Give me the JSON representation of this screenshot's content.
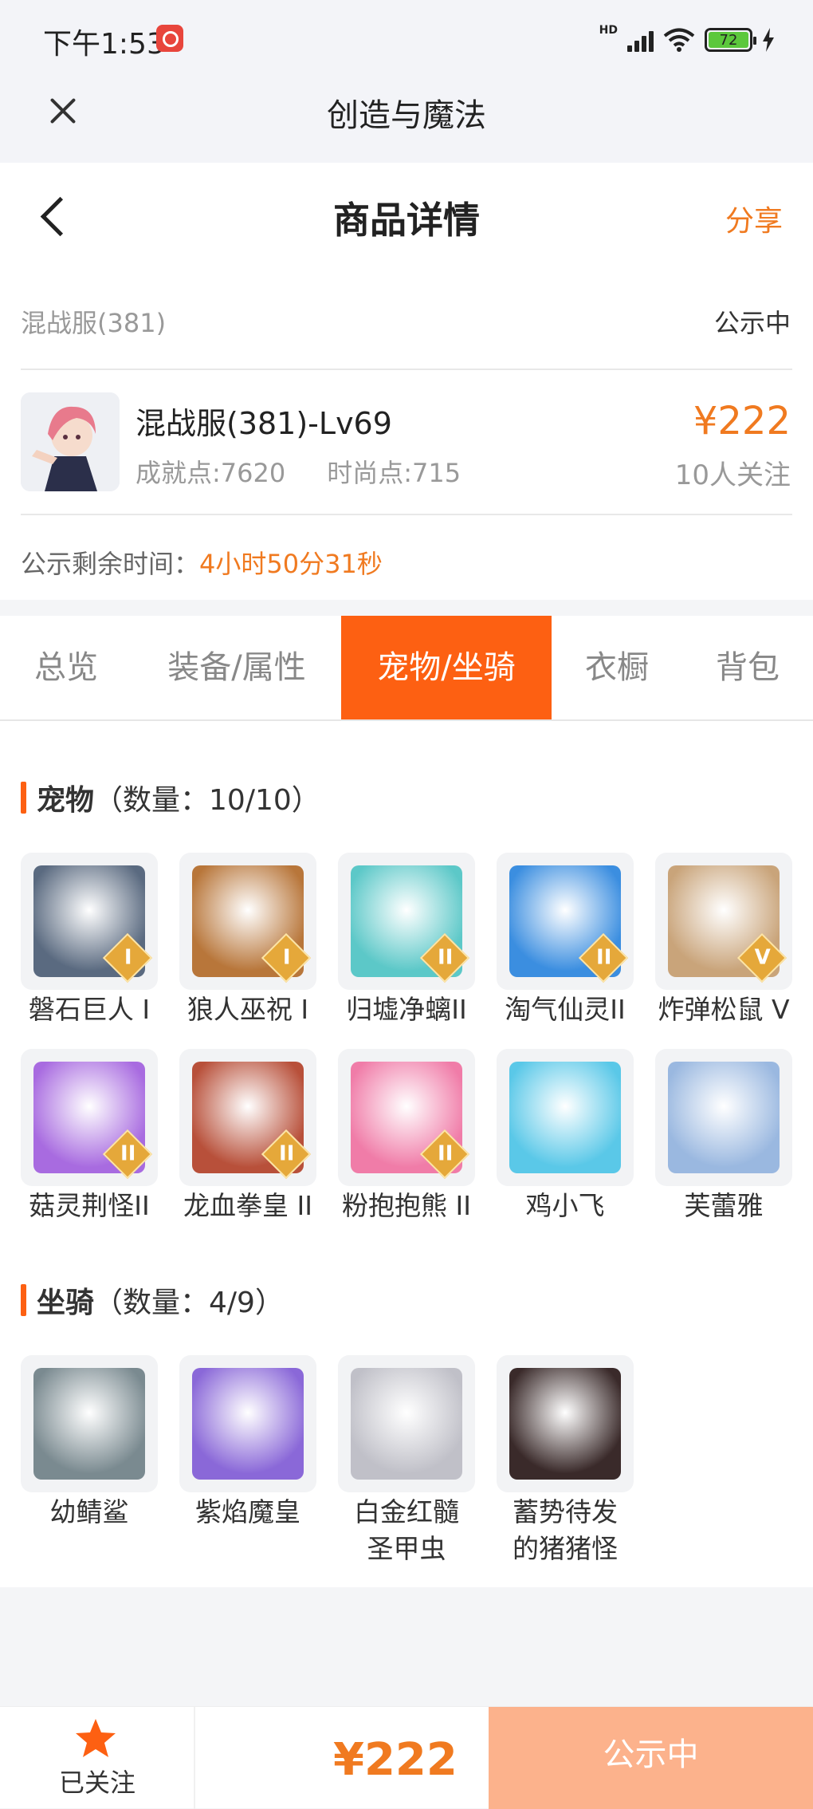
{
  "status_bar": {
    "time": "下午1:53",
    "battery": "72",
    "network": "HD"
  },
  "app_title": "创造与魔法",
  "header": {
    "title": "商品详情",
    "share": "分享"
  },
  "listing": {
    "server": "混战服(381)",
    "status": "公示中",
    "name": "混战服(381)-Lv69",
    "achievement": "成就点:7620",
    "fashion": "时尚点:715",
    "price": "¥222",
    "watchers": "10人关注",
    "remaining_label": "公示剩余时间：",
    "remaining_value": "4小时50分31秒"
  },
  "tabs": [
    {
      "label": "总览"
    },
    {
      "label": "装备/属性"
    },
    {
      "label": "宠物/坐骑",
      "active": true
    },
    {
      "label": "衣橱"
    },
    {
      "label": "背包"
    }
  ],
  "pets": {
    "title": "宠物",
    "count": "（数量：10/10）",
    "items": [
      {
        "label": "磐石巨人 I",
        "badge": "I",
        "color": "#5a6a80"
      },
      {
        "label": "狼人巫祝 I",
        "badge": "I",
        "color": "#b8763a"
      },
      {
        "label": "归墟净螭II",
        "badge": "II",
        "color": "#5cc8c8"
      },
      {
        "label": "淘气仙灵II",
        "badge": "II",
        "color": "#3b8ee0"
      },
      {
        "label": "炸弹松鼠 V",
        "badge": "V",
        "color": "#c9a47a"
      },
      {
        "label": "菇灵荆怪II",
        "badge": "II",
        "color": "#a86be0"
      },
      {
        "label": "龙血拳皇 II",
        "badge": "II",
        "color": "#b8503a"
      },
      {
        "label": "粉抱抱熊 II",
        "badge": "II",
        "color": "#f07ca8"
      },
      {
        "label": "鸡小飞",
        "badge": "",
        "color": "#5ac8e8"
      },
      {
        "label": "芙蕾雅",
        "badge": "",
        "color": "#9ab8e0"
      }
    ]
  },
  "mounts": {
    "title": "坐骑",
    "count": "（数量：4/9）",
    "items": [
      {
        "label": "幼鲭鲨",
        "color": "#7a8a90"
      },
      {
        "label": "紫焰魔皇",
        "color": "#8a68d8"
      },
      {
        "label": "白金红髓圣甲虫",
        "color": "#c0c0c8"
      },
      {
        "label": "蓄势待发的猪猪怪",
        "color": "#3a2a2a"
      }
    ]
  },
  "bottom_bar": {
    "follow": "已关注",
    "price": "¥222",
    "action": "公示中"
  },
  "colors": {
    "accent": "#fd6012",
    "price": "#f07a20",
    "action_bg": "#fcb28c"
  }
}
